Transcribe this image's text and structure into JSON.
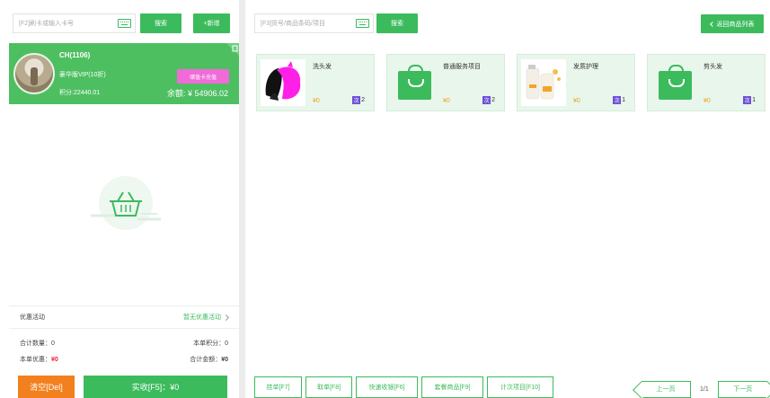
{
  "left": {
    "search_placeholder": "[F2]刷卡或输入卡号",
    "search_btn": "搜索",
    "add_btn": "+新增",
    "member": {
      "name": "CH(1106)",
      "level": "豪华版VIP(10折)",
      "recharge_btn": "储值卡充值",
      "points": "积分:22440.01",
      "balance": "余额: ¥ 54906.02"
    },
    "promo": {
      "label": "优惠活动",
      "value": "暂无优惠活动"
    },
    "totals": {
      "count": "合计数量：0",
      "points": "本单积分：0",
      "discount_label": "本单优惠：",
      "discount_value": "¥0",
      "amount_label": "合计金额：",
      "amount_value": "¥0"
    },
    "clear_btn": "清空[Del]",
    "pay_btn": "实收[F5]：¥0"
  },
  "right": {
    "search_placeholder": "[F3]货号/商品条码/项目",
    "search_btn": "搜索",
    "back_btn": "返回商品列表",
    "goods": [
      {
        "name": "洗头发",
        "price": "¥0",
        "tag": "次",
        "count": "2",
        "thumb": "photo-magenta"
      },
      {
        "name": "普通服务项目",
        "price": "¥0",
        "tag": "次",
        "count": "2",
        "thumb": "bag-icon"
      },
      {
        "name": "发质护理",
        "price": "¥0",
        "tag": "次",
        "count": "1",
        "thumb": "photo-bottle"
      },
      {
        "name": "剪头发",
        "price": "¥0",
        "tag": "次",
        "count": "1",
        "thumb": "bag-icon"
      }
    ],
    "toolbar": [
      "挂单[F7]",
      "取单[F8]",
      "快速收银[F6]",
      "套餐商品[F9]",
      "计次项目[F10]"
    ],
    "pager": {
      "prev": "上一页",
      "page": "1/1",
      "next": "下一页"
    }
  },
  "colors": {
    "accent": "#3cbb5d",
    "recharge": "#f06ad8",
    "clear": "#f2801e",
    "price": "#e9a31b",
    "tag": "#6c4fd6"
  }
}
